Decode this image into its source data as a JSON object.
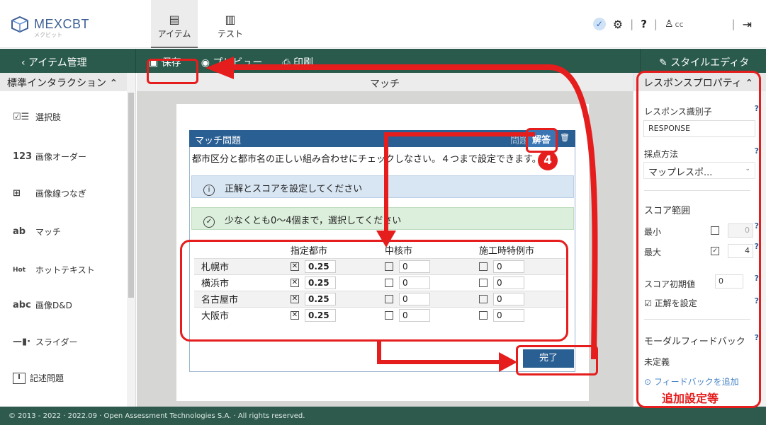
{
  "app": {
    "brand": "MEXCBT",
    "brand_sub": "メクビット",
    "tabs": [
      {
        "label": "アイテム",
        "icon": "item-icon"
      },
      {
        "label": "テスト",
        "icon": "test-icon"
      }
    ],
    "user": "cc"
  },
  "toolbar": {
    "back_label": "‹ アイテム管理",
    "save_label": "保存",
    "preview_label": "プレビュー",
    "print_label": "印刷",
    "style_editor_label": "スタイルエディタ"
  },
  "left_panel": {
    "header": "標準インタラクション",
    "items": [
      {
        "icon_text": "☑☰",
        "label": "選択肢"
      },
      {
        "icon_text": "123",
        "label": "画像オーダー"
      },
      {
        "icon_text": "⊞",
        "label": "画像線つなぎ"
      },
      {
        "icon_text": "ab",
        "label": "マッチ"
      },
      {
        "icon_text": "Hot",
        "label": "ホットテキスト"
      },
      {
        "icon_text": "abc",
        "label": "画像D&D"
      },
      {
        "icon_text": "—▮·",
        "label": "スライダー"
      },
      {
        "icon_text": "I",
        "label": "記述問題"
      }
    ]
  },
  "canvas": {
    "title": "マッチ",
    "question_header": "マッチ問題",
    "mode_hidden_label": "問題",
    "mode_label": "解答",
    "prompt": "都市区分と都市名の正しい組み合わせにチェックしなさい。４つまで設定できます。",
    "info_alert": "正解とスコアを設定してください",
    "ok_alert": "少なくとも0〜4個まで，選択してください",
    "table": {
      "columns": [
        "",
        "指定都市",
        "中核市",
        "施工時特例市"
      ],
      "rows": [
        {
          "city": "札幌市",
          "cells": [
            {
              "checked": true,
              "score": "0.25"
            },
            {
              "checked": false,
              "score": "0"
            },
            {
              "checked": false,
              "score": "0"
            }
          ]
        },
        {
          "city": "横浜市",
          "cells": [
            {
              "checked": true,
              "score": "0.25"
            },
            {
              "checked": false,
              "score": "0"
            },
            {
              "checked": false,
              "score": "0"
            }
          ]
        },
        {
          "city": "名古屋市",
          "cells": [
            {
              "checked": true,
              "score": "0.25"
            },
            {
              "checked": false,
              "score": "0"
            },
            {
              "checked": false,
              "score": "0"
            }
          ]
        },
        {
          "city": "大阪市",
          "cells": [
            {
              "checked": true,
              "score": "0.25"
            },
            {
              "checked": false,
              "score": "0"
            },
            {
              "checked": false,
              "score": "0"
            }
          ]
        }
      ]
    },
    "done_label": "完了"
  },
  "right_panel": {
    "header": "レスポンスプロパティ",
    "response_id_label": "レスポンス識別子",
    "response_id_value": "RESPONSE",
    "scoring_label": "採点方法",
    "scoring_value": "マップレスポ...",
    "score_range_label": "スコア範囲",
    "min_label": "最小",
    "min_value": "0",
    "max_label": "最大",
    "max_value": "4",
    "initial_label": "スコア初期値",
    "initial_value": "0",
    "set_correct_label": "正解を設定",
    "modal_feedback_label": "モーダルフィードバック",
    "undefined_label": "未定義",
    "add_feedback_label": "フィードバックを追加"
  },
  "annotations": {
    "step_number": "4",
    "extra_settings": "追加設定等",
    "color": "#e51d1d"
  },
  "footer": "© 2013 - 2022 · 2022.09 · Open Assessment Technologies S.A. · All rights reserved.",
  "colors": {
    "header_green": "#295a4b",
    "question_blue": "#2a5f93"
  }
}
